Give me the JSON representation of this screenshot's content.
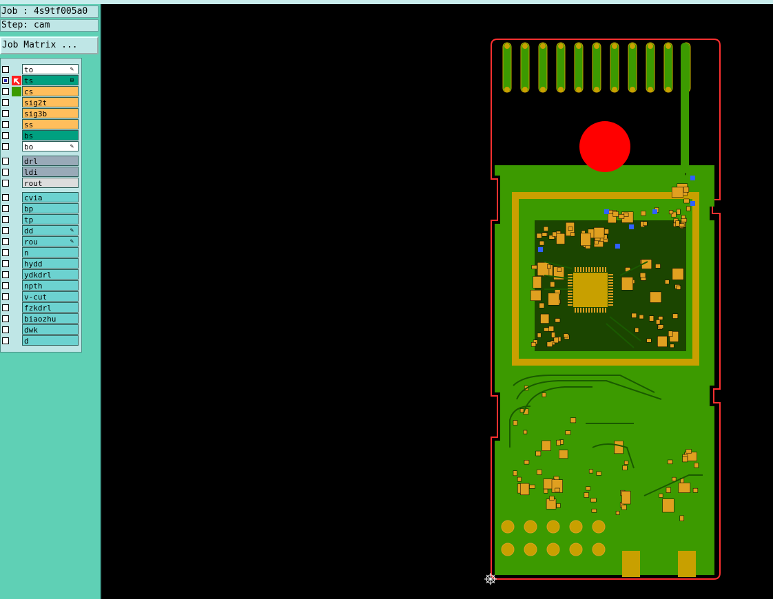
{
  "header": {
    "job_line": "Job : 4s9tf005a0",
    "step_line": "Step: cam"
  },
  "job_matrix_button": "Job Matrix ...",
  "layers": [
    {
      "name": "to",
      "color": "#ffffff",
      "flag": "✎"
    },
    {
      "name": "ts",
      "color": "#00a080",
      "flag": "⊞",
      "active": true
    },
    {
      "name": "cs",
      "color": "#ffbe5c",
      "flag": ""
    },
    {
      "name": "sig2t",
      "color": "#ffbe5c",
      "flag": ""
    },
    {
      "name": "sig3b",
      "color": "#ffbe5c",
      "flag": ""
    },
    {
      "name": "ss",
      "color": "#ffbe5c",
      "flag": ""
    },
    {
      "name": "bs",
      "color": "#00a080",
      "flag": ""
    },
    {
      "name": "bo",
      "color": "#ffffff",
      "flag": "✎"
    },
    {
      "name": "drl",
      "color": "#99aab8",
      "flag": ""
    },
    {
      "name": "ldi",
      "color": "#99aab8",
      "flag": ""
    },
    {
      "name": "rout",
      "color": "#dddddd",
      "flag": ""
    },
    {
      "name": "cvia",
      "color": "#6cd2d0",
      "flag": ""
    },
    {
      "name": "bp",
      "color": "#6cd2d0",
      "flag": ""
    },
    {
      "name": "tp",
      "color": "#6cd2d0",
      "flag": ""
    },
    {
      "name": "dd",
      "color": "#6cd2d0",
      "flag": "✎"
    },
    {
      "name": "rou",
      "color": "#6cd2d0",
      "flag": "✎"
    },
    {
      "name": "n",
      "color": "#6cd2d0",
      "flag": ""
    },
    {
      "name": "hydd",
      "color": "#6cd2d0",
      "flag": ""
    },
    {
      "name": "ydkdrl",
      "color": "#6cd2d0",
      "flag": ""
    },
    {
      "name": "npth",
      "color": "#6cd2d0",
      "flag": ""
    },
    {
      "name": "v-cut",
      "color": "#6cd2d0",
      "flag": ""
    },
    {
      "name": "fzkdrl",
      "color": "#6cd2d0",
      "flag": ""
    },
    {
      "name": "biaozhu",
      "color": "#6cd2d0",
      "flag": ""
    },
    {
      "name": "dwk",
      "color": "#6cd2d0",
      "flag": ""
    },
    {
      "name": "d",
      "color": "#6cd2d0",
      "flag": ""
    }
  ],
  "colors": {
    "board_green": "#3c9a00",
    "copper": "#c8a000",
    "pad": "#e0a020",
    "outline": "#ff3030",
    "dot": "#ff0000",
    "via_blue": "#3060ff"
  },
  "icons": {
    "active_layer_marker": "arrow-cursor-icon",
    "cs_layer_marker": "green-square-icon",
    "crosshair": "crosshair-icon"
  }
}
